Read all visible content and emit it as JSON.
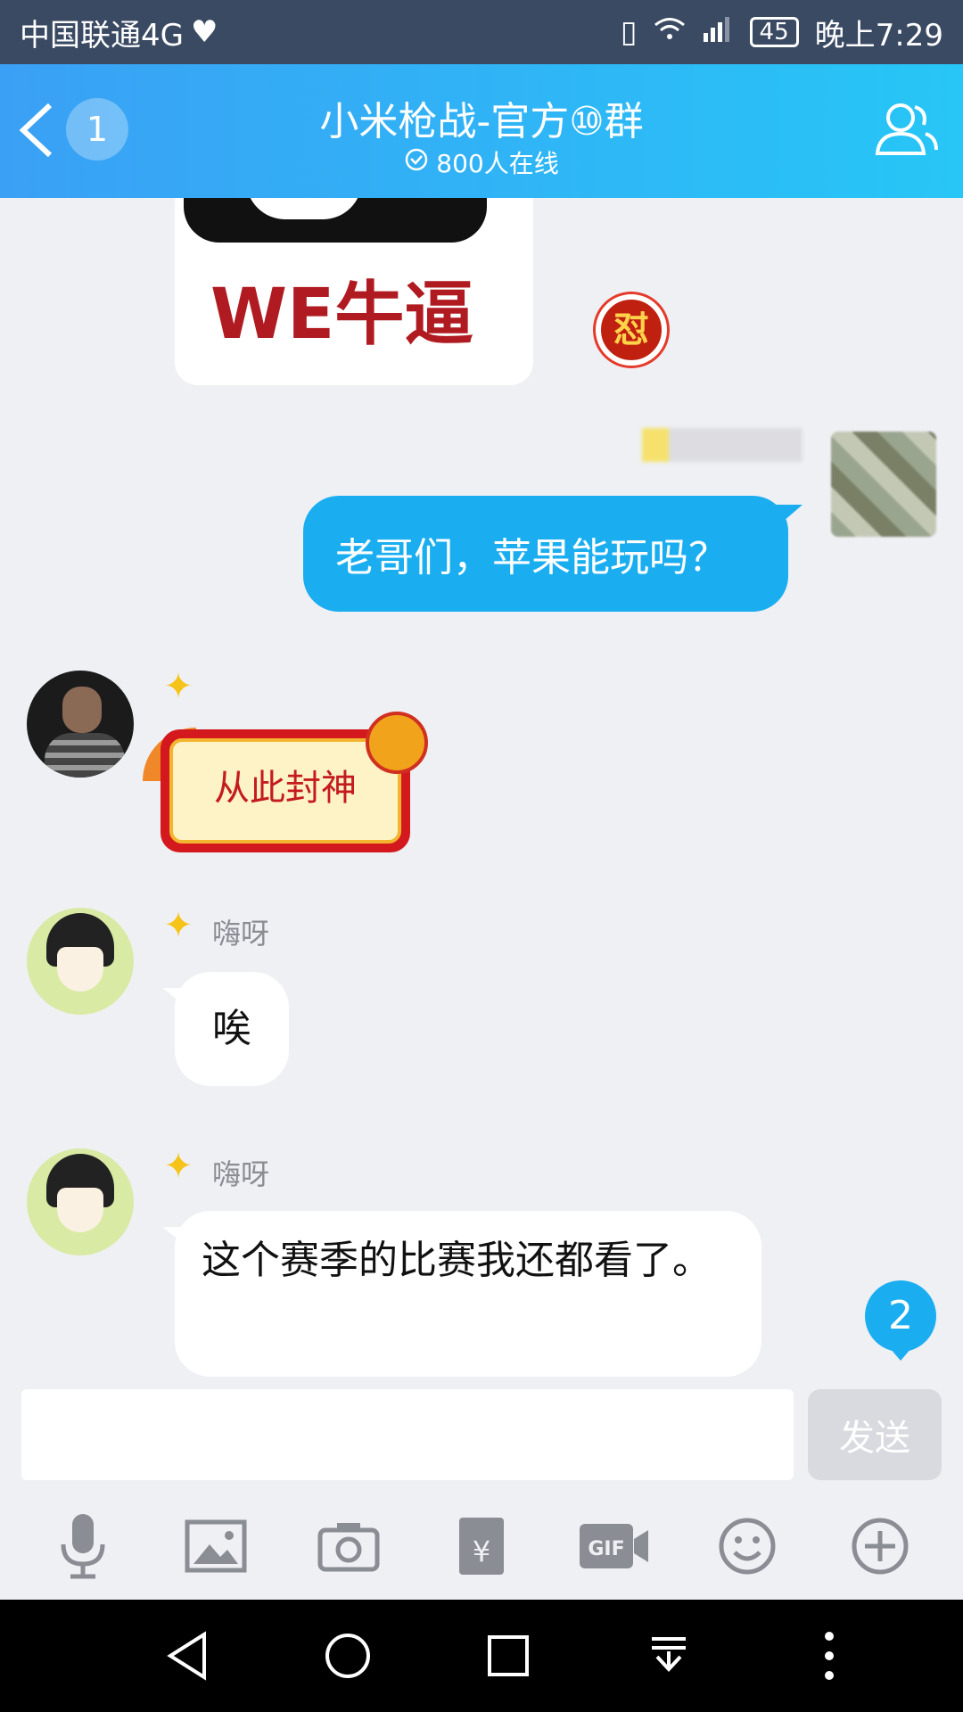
{
  "status_bar": {
    "carrier": "中国联通4G",
    "battery": "45",
    "time": "晚上7:29"
  },
  "header": {
    "unread_count": "1",
    "title": "小米枪战-官方⑩群",
    "online": "800人在线"
  },
  "messages": [
    {
      "type": "sticker",
      "text": "WE牛逼",
      "badge": "怼"
    },
    {
      "type": "text",
      "sender": "self",
      "text": "老哥们，苹果能玩吗？"
    },
    {
      "type": "sticker",
      "text": "从此封神"
    },
    {
      "type": "text",
      "nickname": "嗨呀",
      "text": "唉"
    },
    {
      "type": "text",
      "nickname": "嗨呀",
      "text": "这个赛季的比赛我还都看了。"
    }
  ],
  "new_message_count": "2",
  "input": {
    "value": "",
    "send_label": "发送"
  },
  "toolbar": [
    "mic-icon",
    "image-icon",
    "camera-icon",
    "red-packet-icon",
    "gif-icon",
    "emoji-icon",
    "plus-icon"
  ],
  "nav": [
    "back-triangle-icon",
    "home-circle-icon",
    "recents-square-icon",
    "notification-pulldown-icon",
    "more-dots-icon"
  ],
  "colors": {
    "header": "#27c6f6",
    "self_bubble": "#1aaef0",
    "status_bar": "#3a4a63"
  }
}
